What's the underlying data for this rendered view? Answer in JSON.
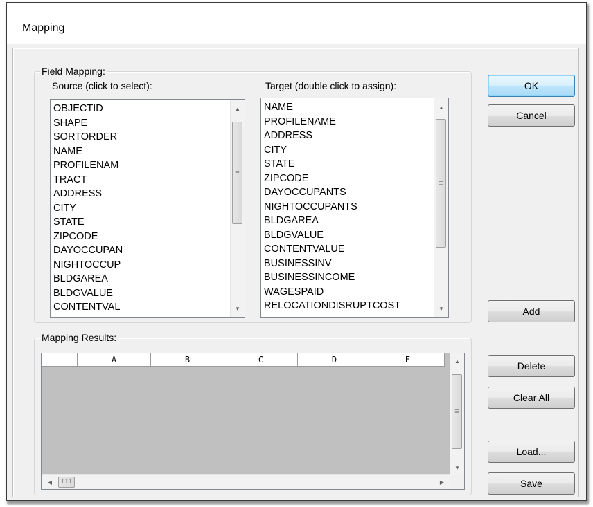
{
  "window": {
    "title": "Mapping"
  },
  "field_mapping": {
    "legend": "Field Mapping:",
    "source_label": "Source (click to select):",
    "target_label": "Target (double click to assign):",
    "source_items": [
      "OBJECTID",
      "SHAPE",
      "SORTORDER",
      "NAME",
      "PROFILENAM",
      "TRACT",
      "ADDRESS",
      "CITY",
      "STATE",
      "ZIPCODE",
      "DAYOCCUPAN",
      "NIGHTOCCUP",
      "BLDGAREA",
      "BLDGVALUE",
      "CONTENTVAL"
    ],
    "target_items": [
      "NAME",
      "PROFILENAME",
      "ADDRESS",
      "CITY",
      "STATE",
      "ZIPCODE",
      "DAYOCCUPANTS",
      "NIGHTOCCUPANTS",
      "BLDGAREA",
      "BLDGVALUE",
      "CONTENTVALUE",
      "BUSINESSINV",
      "BUSINESSINCOME",
      "WAGESPAID",
      "RELOCATIONDISRUPTCOST"
    ]
  },
  "mapping_results": {
    "legend": "Mapping Results:",
    "columns": [
      "A",
      "B",
      "C",
      "D",
      "E"
    ]
  },
  "buttons": {
    "ok": "OK",
    "cancel": "Cancel",
    "add": "Add",
    "delete": "Delete",
    "clear_all": "Clear All",
    "load": "Load...",
    "save": "Save"
  },
  "icons": {
    "scroll_up": "▲",
    "scroll_down": "▼",
    "scroll_left": "◀",
    "scroll_right": "▶",
    "grip_vertical": "≡",
    "grip_horizontal": "III"
  }
}
